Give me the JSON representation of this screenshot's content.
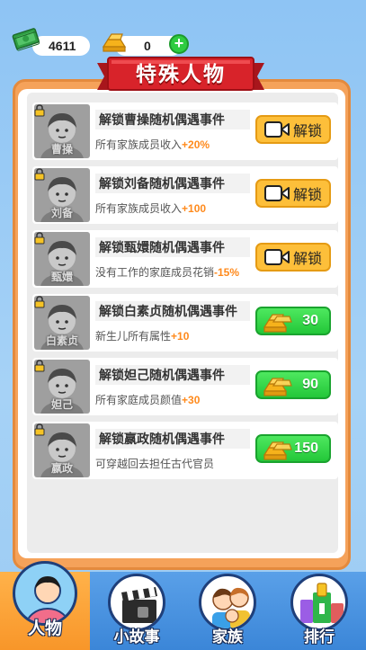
{
  "currency": {
    "cash": "4611",
    "gold": "0"
  },
  "title": "特殊人物",
  "characters": [
    {
      "name": "曹操",
      "title": "解锁曹操随机偶遇事件",
      "desc": "所有家族成员收入",
      "bonus": "+20%",
      "unlock": "video",
      "button_label": "解锁"
    },
    {
      "name": "刘备",
      "title": "解锁刘备随机偶遇事件",
      "desc": "所有家族成员收入",
      "bonus": "+100",
      "unlock": "video",
      "button_label": "解锁"
    },
    {
      "name": "甄嬛",
      "title": "解锁甄嬛随机偶遇事件",
      "desc": "没有工作的家庭成员花销",
      "bonus": "-15%",
      "unlock": "video",
      "button_label": "解锁"
    },
    {
      "name": "白素贞",
      "title": "解锁白素贞随机偶遇事件",
      "desc": "新生儿所有属性",
      "bonus": "+10",
      "unlock": "gold",
      "price": "30"
    },
    {
      "name": "妲己",
      "title": "解锁妲己随机偶遇事件",
      "desc": "所有家庭成员颜值",
      "bonus": "+30",
      "unlock": "gold",
      "price": "90"
    },
    {
      "name": "嬴政",
      "title": "解锁嬴政随机偶遇事件",
      "desc": "可穿越回去担任古代官员",
      "bonus": "",
      "unlock": "gold",
      "price": "150"
    }
  ],
  "nav": [
    {
      "label": "人物",
      "icon": "person-icon",
      "active": true
    },
    {
      "label": "小故事",
      "icon": "clapperboard-icon",
      "active": false
    },
    {
      "label": "家族",
      "icon": "family-icon",
      "active": false
    },
    {
      "label": "排行",
      "icon": "trophy-icon",
      "active": false
    }
  ],
  "colors": {
    "accent": "#f5a25a",
    "banner": "#d8232a",
    "gold_button": "#2ecc40",
    "video_button": "#fdbf3a",
    "bonus_text": "#ff8a1c",
    "nav": "#3b86d8"
  }
}
